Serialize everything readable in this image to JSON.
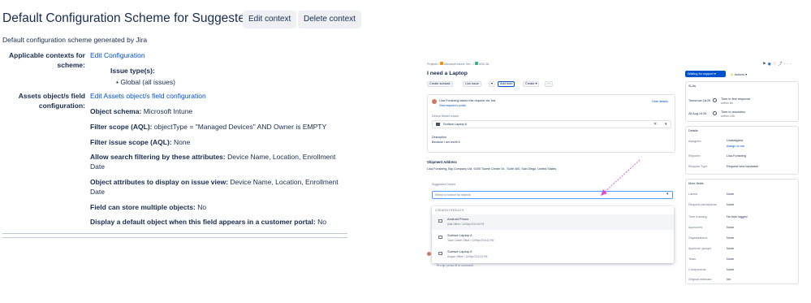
{
  "config": {
    "title": "Default Configuration Scheme for Suggested Device",
    "edit_context_label": "Edit context",
    "delete_context_label": "Delete context",
    "description": "Default configuration scheme generated by Jira",
    "applicable_contexts_label_1": "Applicable contexts for",
    "applicable_contexts_label_2": "scheme:",
    "edit_configuration_link": "Edit Configuration",
    "issue_types_label": "Issue type(s):",
    "issue_type_value": "Global (all issues)",
    "assets_label_1": "Assets object/s field",
    "assets_label_2": "configuration:",
    "edit_assets_link": "Edit Assets object/s field configuration",
    "object_schema_label": "Object schema:",
    "object_schema_value": "Microsoft Intune",
    "filter_scope_label": "Filter scope (AQL):",
    "filter_scope_value": "objectType = \"Managed Devices\" AND Owner is EMPTY",
    "filter_issue_label": "Filter issue scope (AQL):",
    "filter_issue_value": "None",
    "allow_search_label": "Allow search filtering by these attributes:",
    "allow_search_value": "Device Name, Location, Enrollment Date",
    "attrs_display_label": "Object attributes to display on issue view:",
    "attrs_display_value": "Device Name, Location, Enrollment Date",
    "multiple_label": "Field can store multiple objects:",
    "multiple_value": "No",
    "default_object_label": "Display a default object when this field appears in a customer portal:",
    "default_object_value": "No"
  },
  "jira": {
    "breadcrumb_projects": "Projects",
    "breadcrumb_project": "Microsoft Intune Ser...",
    "breadcrumb_issue": "ASD-36",
    "issue_title": "I need a Laptop",
    "create_subtask": "Create subtask",
    "link_issue": "Link issue",
    "add_form": "Add form",
    "create": "Create",
    "status": "Waiting for support",
    "actions": "Actions",
    "requester_line": "Lisa Fonsberg raised this request via Jira",
    "view_in_portal": "View request in portal",
    "hide_details": "Hide details",
    "device_model_label": "Device Model choice",
    "device_model_value": "Surface Laptop 6",
    "description_label": "Description",
    "description_value": "Because I am worth it",
    "shipment_label": "Shipment Address",
    "shipment_value": "Lisa Fonsberg, Big Company Ltd, 9255 Towne Center Dr., Suite 400, San Diego, United States",
    "suggested_label": "Suggested Device",
    "search_placeholder": "Select or search for objects",
    "results_header": "3 SEARCH RESULTS",
    "results": [
      {
        "name": "Android Phone",
        "meta": "Altai Office / 12/Sep/23 8:43 PM"
      },
      {
        "name": "Surface Laptop 6",
        "meta": "Team Center Office / 12/Sep/23 8:43 PM"
      },
      {
        "name": "Surface Laptop 6",
        "meta": "Aragon Office / 12/Sep/23 8:43 PM"
      }
    ],
    "pro_tip": "Pro tip: press M to comment",
    "slas_label": "SLAs",
    "sla1_time": "Tomorrow 18:26",
    "sla1_text_1": "Time to first response",
    "sla1_text_2": "within 8h",
    "sla2_time": "28 Aug 14:26",
    "sla2_text_1": "Time to resolution",
    "sla2_text_2": "within 24h",
    "details_label": "Details",
    "assignee_label": "Assignee",
    "assignee_value": "Unassigned",
    "assign_to_me": "Assign to me",
    "reporter_label": "Reporter",
    "reporter_value": "Lisa Fonsberg",
    "request_type_label": "Request Type",
    "request_type_value": "Request new hardware",
    "more_fields": "More fields",
    "fields": [
      {
        "label": "Labels",
        "value": "None"
      },
      {
        "label": "Request participants",
        "value": "None"
      },
      {
        "label": "Time tracking",
        "value": "No time logged"
      },
      {
        "label": "Approvers",
        "value": "None"
      },
      {
        "label": "Organizations",
        "value": "None"
      },
      {
        "label": "Approver groups",
        "value": "None"
      },
      {
        "label": "Team",
        "value": "None"
      },
      {
        "label": "Components",
        "value": "None"
      },
      {
        "label": "Original estimate",
        "value": "0m"
      }
    ],
    "colors": {
      "accent": "#0052cc",
      "arrow": "#d94fd3",
      "status_bg": "#0052cc"
    }
  }
}
